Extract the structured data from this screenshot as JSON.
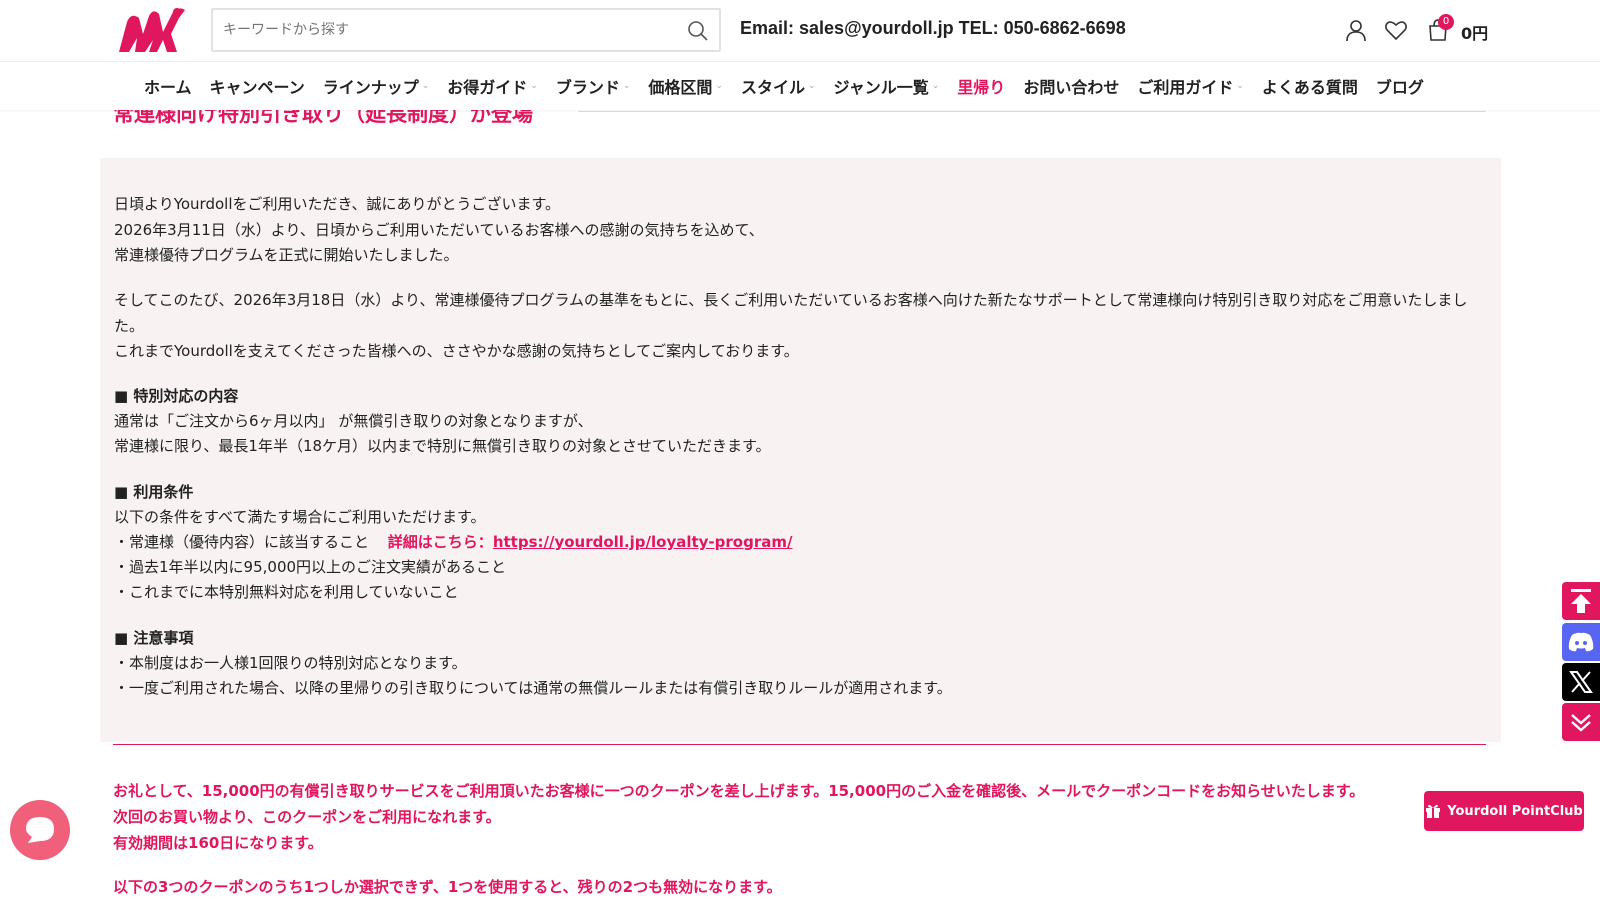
{
  "header": {
    "search_placeholder": "キーワードから探す",
    "contact": "Email: sales@yourdoll.jp TEL: 050-6862-6698",
    "cart_count": "0",
    "cart_total": "0円"
  },
  "nav": {
    "items": [
      {
        "label": "ホーム",
        "caret": false
      },
      {
        "label": "キャンペーン",
        "caret": false
      },
      {
        "label": "ラインナップ",
        "caret": true
      },
      {
        "label": "お得ガイド",
        "caret": true
      },
      {
        "label": "ブランド",
        "caret": true
      },
      {
        "label": "価格区間",
        "caret": true
      },
      {
        "label": "スタイル",
        "caret": true
      },
      {
        "label": "ジャンル一覧",
        "caret": true
      },
      {
        "label": "里帰り",
        "caret": false,
        "active": true
      },
      {
        "label": "お問い合わせ",
        "caret": false
      },
      {
        "label": "ご利用ガイド",
        "caret": true
      },
      {
        "label": "よくある質問",
        "caret": false
      },
      {
        "label": "ブログ",
        "caret": false
      }
    ]
  },
  "page": {
    "heading": "常連様向け特別引き取り（延長制度）が登場"
  },
  "notice": {
    "intro1": "日頃よりYourdollをご利用いただき、誠にありがとうございます。",
    "intro2": "2026年3月11日（水）より、日頃からご利用いただいているお客様への感謝の気持ちを込めて、",
    "intro3": "常連様優待プログラムを正式に開始いたしました。",
    "para2": "そしてこのたび、2026年3月18日（水）より、常連様優待プログラムの基準をもとに、長くご利用いただいているお客様へ向けた新たなサポートとして常連様向け特別引き取り対応をご用意いたしました。",
    "para3": "これまでYourdollを支えてくださった皆様への、ささやかな感謝の気持ちとしてご案内しております。",
    "sec1_title": "■ 特別対応の内容",
    "sec1_l1": "通常は「ご注文から6ヶ月以内」 が無償引き取りの対象となりますが、",
    "sec1_l2": "常連様に限り、最長1年半（18ケ月）以内まで特別に無償引き取りの対象とさせていただきます。",
    "sec2_title": "■ 利用条件",
    "sec2_l1": "以下の条件をすべて満たす場合にご利用いただけます。",
    "sec2_l2": "・常連様（優待内容）に該当すること",
    "sec2_detail": "詳細はこちら：",
    "sec2_link": "https://yourdoll.jp/loyalty-program/",
    "sec2_l3": "・過去1年半以内に95,000円以上のご注文実績があること",
    "sec2_l4": "・これまでに本特別無料対応を利用していないこと",
    "sec3_title": "■ 注意事項",
    "sec3_l1": "・本制度はお一人様1回限りの特別対応となります。",
    "sec3_l2": "・一度ご利用された場合、以降の里帰りの引き取りについては通常の無償ルールまたは有償引き取りルールが適用されます。"
  },
  "coupon": {
    "l1": "お礼として、15,000円の有償引き取りサービスをご利用頂いたお客様に一つのクーポンを差し上げます。15,000円のご入金を確認後、メールでクーポンコードをお知らせいたします。",
    "l2": "次回のお買い物より、このクーポンをご利用になれます。",
    "l3": "有効期間は160日になります。",
    "l4": "以下の3つのクーポンのうち1つしか選択できず、1つを使用すると、残りの2つも無効になります。"
  },
  "floating": {
    "pointclub": "Yourdoll PointClub"
  },
  "colors": {
    "accent": "#e0165f",
    "notice_bg": "#f8f2f3",
    "discord": "#5865f2"
  }
}
